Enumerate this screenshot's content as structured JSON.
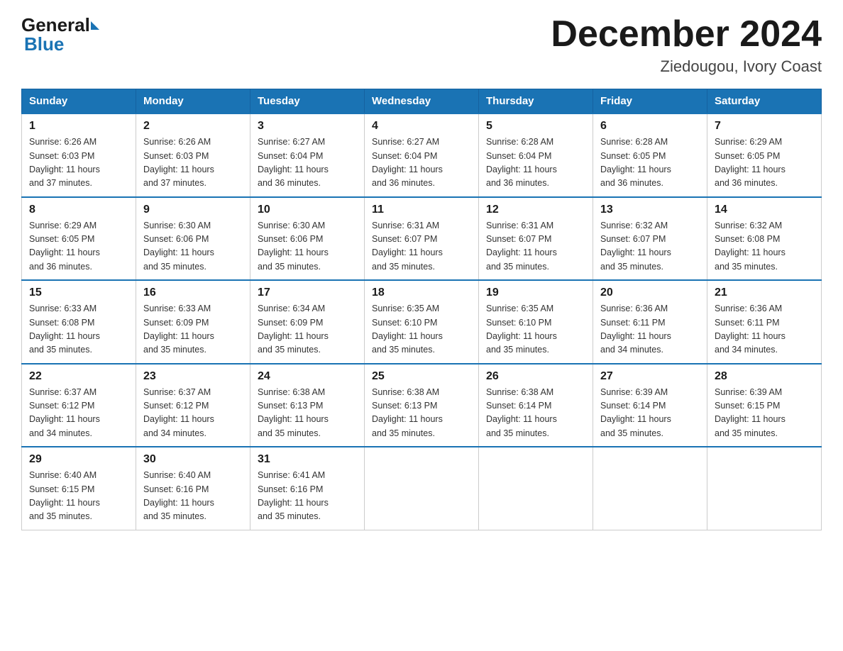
{
  "logo": {
    "general": "General",
    "blue": "Blue"
  },
  "title": {
    "month": "December 2024",
    "location": "Ziedougou, Ivory Coast"
  },
  "headers": [
    "Sunday",
    "Monday",
    "Tuesday",
    "Wednesday",
    "Thursday",
    "Friday",
    "Saturday"
  ],
  "weeks": [
    [
      {
        "day": "1",
        "info": "Sunrise: 6:26 AM\nSunset: 6:03 PM\nDaylight: 11 hours\nand 37 minutes."
      },
      {
        "day": "2",
        "info": "Sunrise: 6:26 AM\nSunset: 6:03 PM\nDaylight: 11 hours\nand 37 minutes."
      },
      {
        "day": "3",
        "info": "Sunrise: 6:27 AM\nSunset: 6:04 PM\nDaylight: 11 hours\nand 36 minutes."
      },
      {
        "day": "4",
        "info": "Sunrise: 6:27 AM\nSunset: 6:04 PM\nDaylight: 11 hours\nand 36 minutes."
      },
      {
        "day": "5",
        "info": "Sunrise: 6:28 AM\nSunset: 6:04 PM\nDaylight: 11 hours\nand 36 minutes."
      },
      {
        "day": "6",
        "info": "Sunrise: 6:28 AM\nSunset: 6:05 PM\nDaylight: 11 hours\nand 36 minutes."
      },
      {
        "day": "7",
        "info": "Sunrise: 6:29 AM\nSunset: 6:05 PM\nDaylight: 11 hours\nand 36 minutes."
      }
    ],
    [
      {
        "day": "8",
        "info": "Sunrise: 6:29 AM\nSunset: 6:05 PM\nDaylight: 11 hours\nand 36 minutes."
      },
      {
        "day": "9",
        "info": "Sunrise: 6:30 AM\nSunset: 6:06 PM\nDaylight: 11 hours\nand 35 minutes."
      },
      {
        "day": "10",
        "info": "Sunrise: 6:30 AM\nSunset: 6:06 PM\nDaylight: 11 hours\nand 35 minutes."
      },
      {
        "day": "11",
        "info": "Sunrise: 6:31 AM\nSunset: 6:07 PM\nDaylight: 11 hours\nand 35 minutes."
      },
      {
        "day": "12",
        "info": "Sunrise: 6:31 AM\nSunset: 6:07 PM\nDaylight: 11 hours\nand 35 minutes."
      },
      {
        "day": "13",
        "info": "Sunrise: 6:32 AM\nSunset: 6:07 PM\nDaylight: 11 hours\nand 35 minutes."
      },
      {
        "day": "14",
        "info": "Sunrise: 6:32 AM\nSunset: 6:08 PM\nDaylight: 11 hours\nand 35 minutes."
      }
    ],
    [
      {
        "day": "15",
        "info": "Sunrise: 6:33 AM\nSunset: 6:08 PM\nDaylight: 11 hours\nand 35 minutes."
      },
      {
        "day": "16",
        "info": "Sunrise: 6:33 AM\nSunset: 6:09 PM\nDaylight: 11 hours\nand 35 minutes."
      },
      {
        "day": "17",
        "info": "Sunrise: 6:34 AM\nSunset: 6:09 PM\nDaylight: 11 hours\nand 35 minutes."
      },
      {
        "day": "18",
        "info": "Sunrise: 6:35 AM\nSunset: 6:10 PM\nDaylight: 11 hours\nand 35 minutes."
      },
      {
        "day": "19",
        "info": "Sunrise: 6:35 AM\nSunset: 6:10 PM\nDaylight: 11 hours\nand 35 minutes."
      },
      {
        "day": "20",
        "info": "Sunrise: 6:36 AM\nSunset: 6:11 PM\nDaylight: 11 hours\nand 34 minutes."
      },
      {
        "day": "21",
        "info": "Sunrise: 6:36 AM\nSunset: 6:11 PM\nDaylight: 11 hours\nand 34 minutes."
      }
    ],
    [
      {
        "day": "22",
        "info": "Sunrise: 6:37 AM\nSunset: 6:12 PM\nDaylight: 11 hours\nand 34 minutes."
      },
      {
        "day": "23",
        "info": "Sunrise: 6:37 AM\nSunset: 6:12 PM\nDaylight: 11 hours\nand 34 minutes."
      },
      {
        "day": "24",
        "info": "Sunrise: 6:38 AM\nSunset: 6:13 PM\nDaylight: 11 hours\nand 35 minutes."
      },
      {
        "day": "25",
        "info": "Sunrise: 6:38 AM\nSunset: 6:13 PM\nDaylight: 11 hours\nand 35 minutes."
      },
      {
        "day": "26",
        "info": "Sunrise: 6:38 AM\nSunset: 6:14 PM\nDaylight: 11 hours\nand 35 minutes."
      },
      {
        "day": "27",
        "info": "Sunrise: 6:39 AM\nSunset: 6:14 PM\nDaylight: 11 hours\nand 35 minutes."
      },
      {
        "day": "28",
        "info": "Sunrise: 6:39 AM\nSunset: 6:15 PM\nDaylight: 11 hours\nand 35 minutes."
      }
    ],
    [
      {
        "day": "29",
        "info": "Sunrise: 6:40 AM\nSunset: 6:15 PM\nDaylight: 11 hours\nand 35 minutes."
      },
      {
        "day": "30",
        "info": "Sunrise: 6:40 AM\nSunset: 6:16 PM\nDaylight: 11 hours\nand 35 minutes."
      },
      {
        "day": "31",
        "info": "Sunrise: 6:41 AM\nSunset: 6:16 PM\nDaylight: 11 hours\nand 35 minutes."
      },
      null,
      null,
      null,
      null
    ]
  ]
}
